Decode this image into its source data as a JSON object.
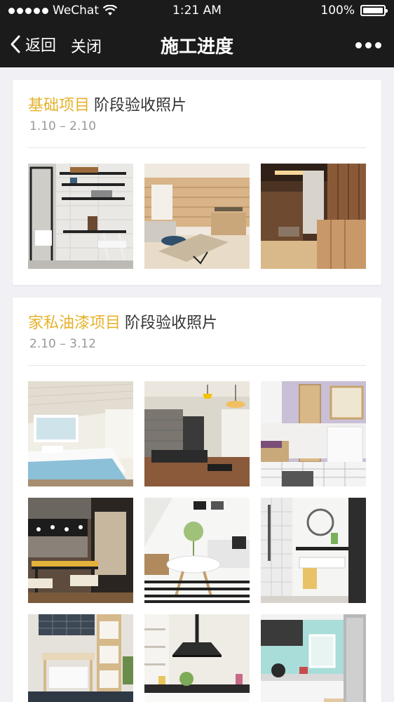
{
  "status_bar": {
    "carrier": "WeChat",
    "time": "1:21 AM",
    "battery": "100%"
  },
  "nav": {
    "back_label": "返回",
    "close_label": "关闭",
    "title": "施工进度"
  },
  "sections": [
    {
      "accent": "基础项目",
      "subtitle": "阶段验收照片",
      "date_range": "1.10 – 2.10",
      "photos": [
        "study-desk-shelves",
        "living-room-wood-wall",
        "cabinet-hallway"
      ]
    },
    {
      "accent": "家私油漆项目",
      "subtitle": "阶段验收照片",
      "date_range": "2.10 – 3.12",
      "photos": [
        "attic-bedroom",
        "living-room-sofa",
        "bathroom-vanity-purple",
        "dining-room",
        "living-room-coffee-table",
        "shower-room",
        "bathroom-wood-vanity",
        "kitchen-range-hood",
        "kitchen-mint"
      ]
    }
  ],
  "colors": {
    "accent": "#e6b22d",
    "topbar": "#1b1b1b"
  },
  "icons": [
    "signal-dots-icon",
    "wifi-icon",
    "battery-icon",
    "chevron-left-icon",
    "more-dots-icon"
  ]
}
